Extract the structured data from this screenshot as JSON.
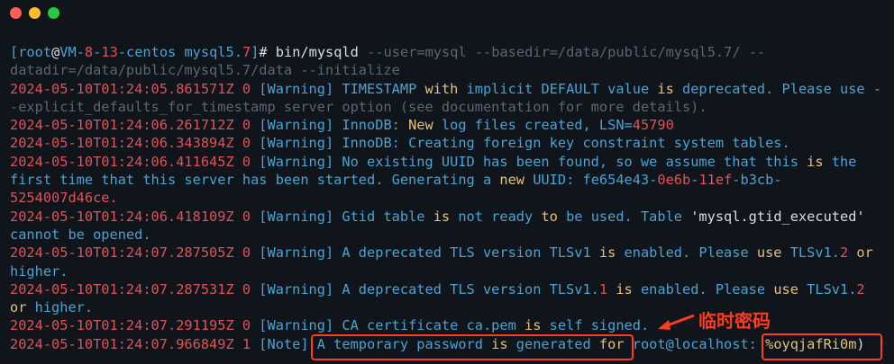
{
  "window": {
    "controls": {
      "close_color": "#ff5f57",
      "minimize_color": "#febc2e",
      "zoom_color": "#28c840"
    }
  },
  "terminal": {
    "lines": [
      "",
      "[root@VM-8-13-centos mysql5.7]# bin/mysqld --user=mysql --basedir=/data/public/mysql5.7/ --",
      "datadir=/data/public/mysql5.7/data --initialize",
      "2024-05-10T01:24:05.861571Z 0 [Warning] TIMESTAMP with implicit DEFAULT value is deprecated. Please use -",
      "-explicit_defaults_for_timestamp server option (see documentation for more details).",
      "2024-05-10T01:24:06.261712Z 0 [Warning] InnoDB: New log files created, LSN=45790",
      "2024-05-10T01:24:06.343894Z 0 [Warning] InnoDB: Creating foreign key constraint system tables.",
      "2024-05-10T01:24:06.411645Z 0 [Warning] No existing UUID has been found, so we assume that this is the",
      "first time that this server has been started. Generating a new UUID: fe654e43-0e6b-11ef-b3cb-",
      "5254007d46ce.",
      "2024-05-10T01:24:06.418109Z 0 [Warning] Gtid table is not ready to be used. Table 'mysql.gtid_executed'",
      "cannot be opened.",
      "2024-05-10T01:24:07.287505Z 0 [Warning] A deprecated TLS version TLSv1 is enabled. Please use TLSv1.2 or",
      "higher.",
      "2024-05-10T01:24:07.287531Z 0 [Warning] A deprecated TLS version TLSv1.1 is enabled. Please use TLSv1.2",
      "or higher.",
      "2024-05-10T01:24:07.291195Z 0 [Warning] CA certificate ca.pem is self signed.",
      "2024-05-10T01:24:07.966849Z 1 [Note] A temporary password is generated for root@localhost: %oyqjafRi0m)"
    ]
  },
  "annotation": {
    "label": "临时密码",
    "color": "#ff3b1f"
  }
}
